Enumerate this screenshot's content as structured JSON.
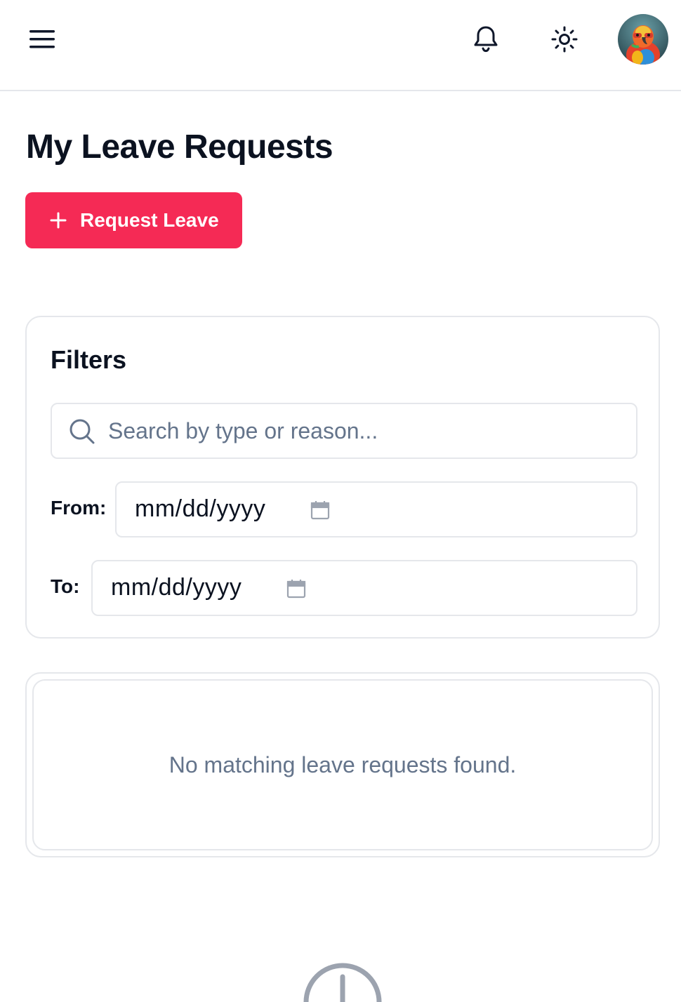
{
  "header": {
    "menu_icon": "hamburger-menu-icon",
    "notification_icon": "bell-icon",
    "theme_icon": "sun-icon",
    "avatar_icon": "parrot-avatar"
  },
  "page": {
    "title": "My Leave Requests",
    "request_button_label": "Request Leave",
    "request_button_icon": "plus-icon"
  },
  "filters": {
    "title": "Filters",
    "search_placeholder": "Search by type or reason...",
    "from_label": "From:",
    "from_value": "mm/dd/yyyy",
    "to_label": "To:",
    "to_value": "mm/dd/yyyy"
  },
  "results": {
    "empty_message": "No matching leave requests found."
  },
  "colors": {
    "primary": "#f52a55",
    "border": "#e5e7eb",
    "muted_text": "#64748b",
    "heading": "#0b1220"
  }
}
